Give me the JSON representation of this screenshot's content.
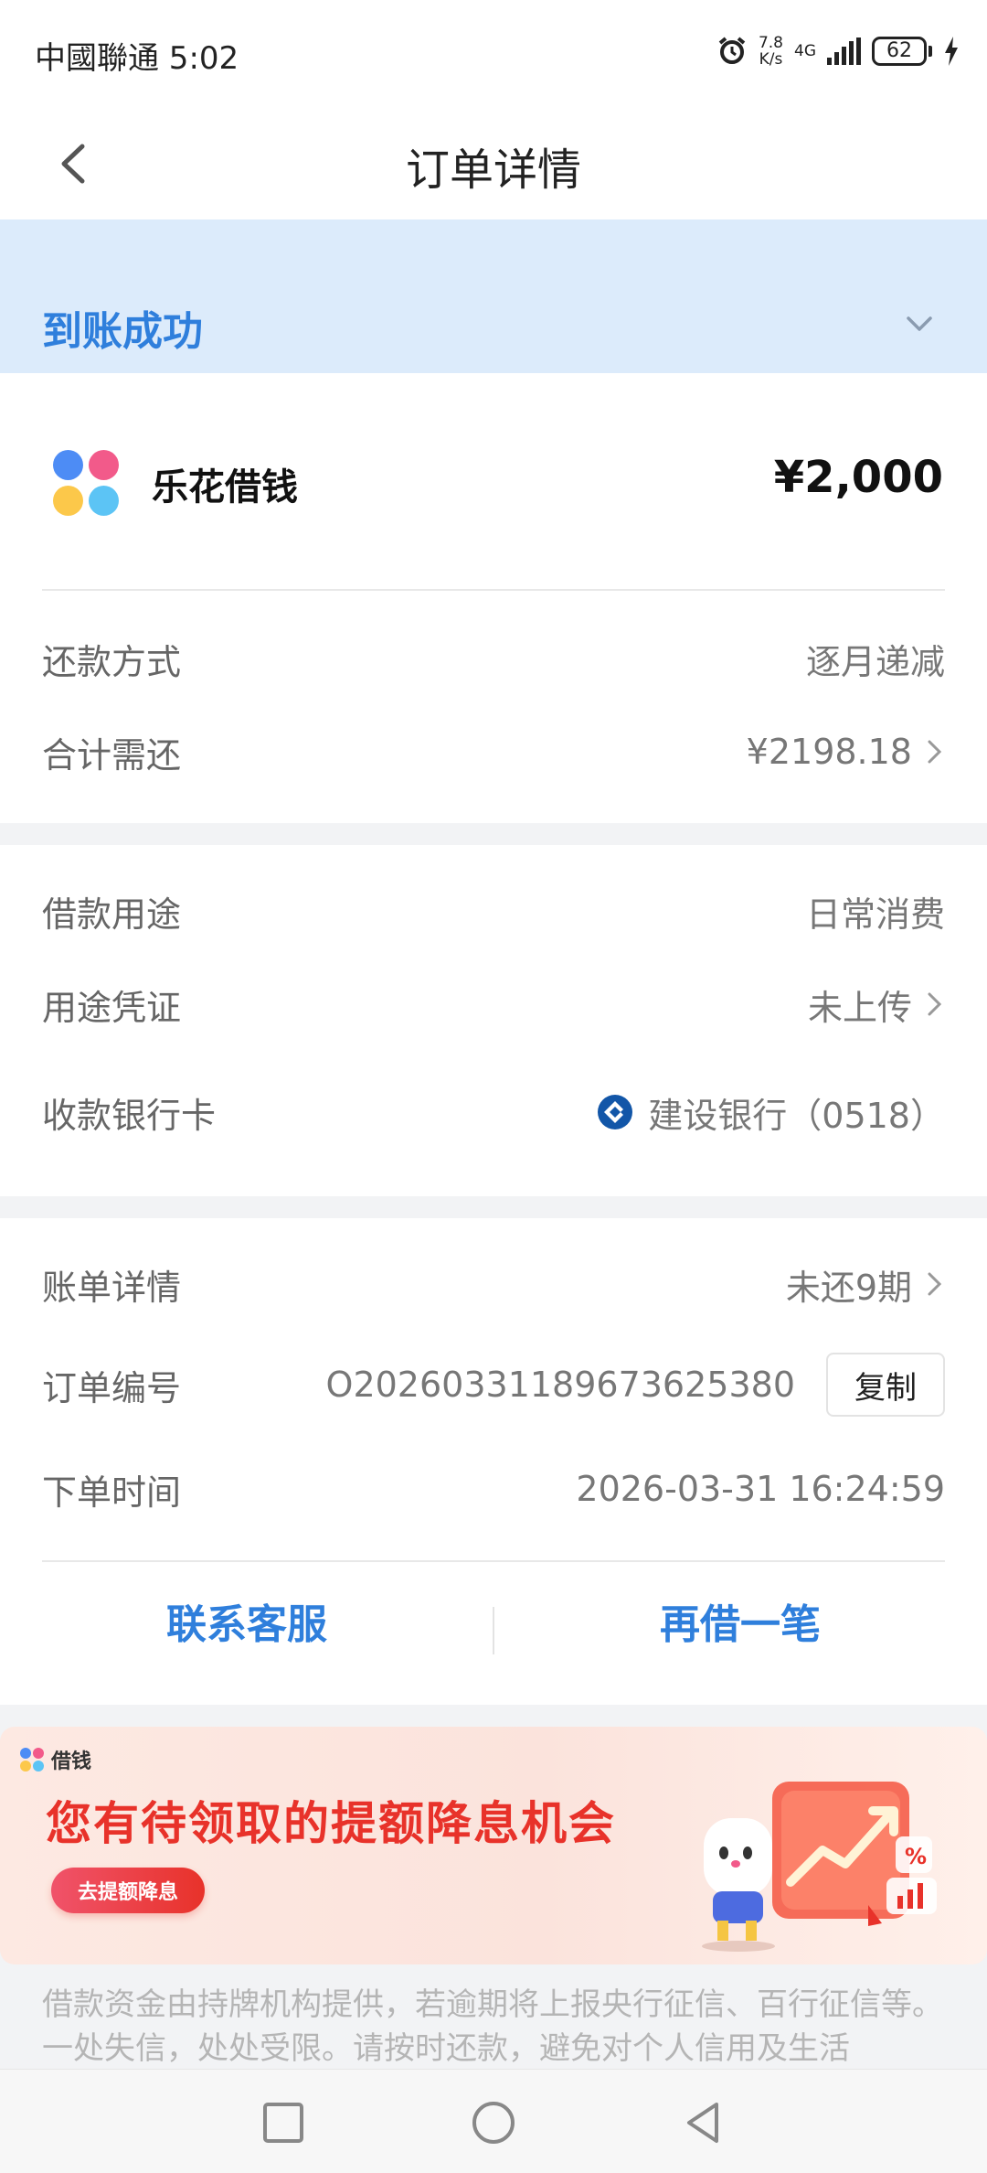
{
  "status_bar": {
    "carrier_time": "中國聯通 5:02",
    "net_speed_top": "7.8",
    "net_speed_bottom": "K/s",
    "network": "4G",
    "battery": "62"
  },
  "nav": {
    "title": "订单详情"
  },
  "status_banner": {
    "text": "到账成功"
  },
  "product": {
    "name": "乐花借钱",
    "amount": "¥2,000"
  },
  "repayment": {
    "method_label": "还款方式",
    "method_value": "逐月递减",
    "total_label": "合计需还",
    "total_value": "¥2198.18"
  },
  "loan_info": {
    "purpose_label": "借款用途",
    "purpose_value": "日常消费",
    "proof_label": "用途凭证",
    "proof_value": "未上传",
    "card_label": "收款银行卡",
    "card_value": "建设银行（0518）"
  },
  "order": {
    "bill_label": "账单详情",
    "bill_value": "未还9期",
    "number_label": "订单编号",
    "number_value": "O20260331189673625380",
    "copy_label": "复制",
    "time_label": "下单时间",
    "time_value": "2026-03-31 16:24:59"
  },
  "actions": {
    "contact": "联系客服",
    "borrow_again": "再借一笔"
  },
  "promo": {
    "tag": "借钱",
    "title": "您有待领取的提额降息机会",
    "button": "去提额降息"
  },
  "disclaimer": "借款资金由持牌机构提供，若逾期将上报央行征信、百行征信等。一处失信，处处受限。请按时还款，避免对个人信用及生活",
  "colors": {
    "accent": "#2f7fdc",
    "banner_bg": "#dcebfb",
    "promo_red": "#e8322a"
  }
}
